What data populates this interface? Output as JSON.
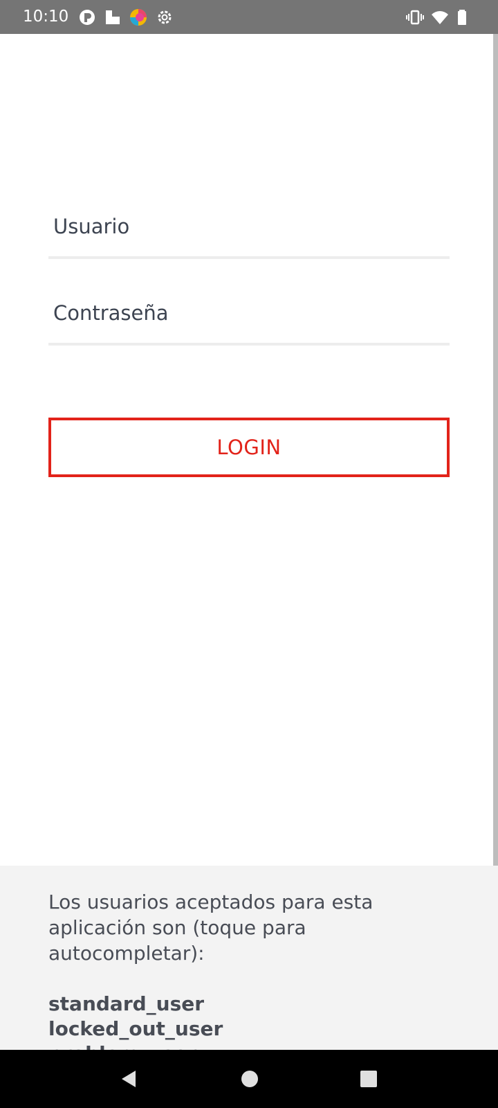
{
  "status_bar": {
    "time": "10:10"
  },
  "form": {
    "username_placeholder": "Usuario",
    "password_placeholder": "Contraseña",
    "login_label": "LOGIN"
  },
  "info": {
    "description": "Los usuarios aceptados para esta aplicación son (toque para autocompletar):",
    "users": [
      "standard_user",
      "locked_out_user",
      "problem_user"
    ]
  },
  "colors": {
    "accent": "#e2231a",
    "status_bar": "#757575",
    "panel": "#f3f3f3",
    "text": "#3d4451"
  }
}
